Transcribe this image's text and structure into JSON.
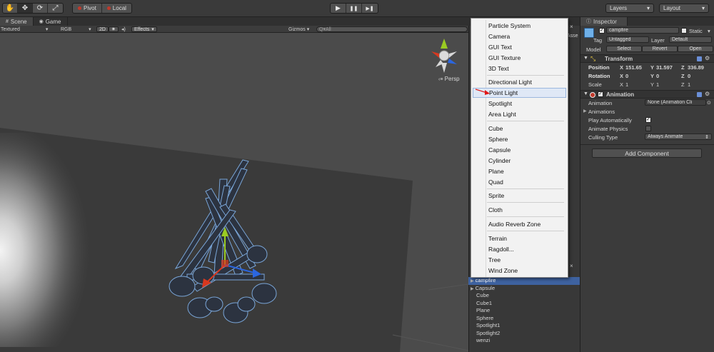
{
  "toolbar": {
    "tools": [
      "hand-icon",
      "move-icon",
      "rotate-icon",
      "scale-icon"
    ],
    "pivot_label": "Pivot",
    "local_label": "Local",
    "play_icons": [
      "▶",
      "❚❚",
      "▶❚"
    ],
    "layers_label": "Layers",
    "layout_label": "Layout"
  },
  "scene": {
    "tabs": [
      {
        "label": "Scene"
      },
      {
        "label": "Game"
      }
    ],
    "controls": {
      "shading": "Textured",
      "render_mode": "RGB",
      "mode_2d": "2D",
      "effects": "Effects",
      "gizmos": "Gizmos",
      "search_placeholder": "Q▾All"
    },
    "projection_label": "Persp"
  },
  "context_menu": {
    "items": [
      {
        "label": "Particle System"
      },
      {
        "label": "Camera"
      },
      {
        "label": "GUI Text"
      },
      {
        "label": "GUI Texture"
      },
      {
        "label": "3D Text"
      },
      {
        "label": "Directional Light"
      },
      {
        "label": "Point Light",
        "highlighted": true
      },
      {
        "label": "Spotlight"
      },
      {
        "label": "Area Light"
      },
      {
        "label": "Cube"
      },
      {
        "label": "Sphere"
      },
      {
        "label": "Capsule"
      },
      {
        "label": "Cylinder"
      },
      {
        "label": "Plane"
      },
      {
        "label": "Quad"
      },
      {
        "label": "Sprite"
      },
      {
        "label": "Cloth"
      },
      {
        "label": "Audio Reverb Zone"
      },
      {
        "label": "Terrain"
      },
      {
        "label": "Ragdoll..."
      },
      {
        "label": "Tree"
      },
      {
        "label": "Wind Zone"
      }
    ]
  },
  "hierarchy": {
    "partial_label": "Asse",
    "close_glyph": "×",
    "items": [
      {
        "label": "campfire",
        "selected": true,
        "expandable": true
      },
      {
        "label": "Capsule",
        "expandable": true
      },
      {
        "label": "Cube"
      },
      {
        "label": "Cube1"
      },
      {
        "label": "Plane"
      },
      {
        "label": "Sphere"
      },
      {
        "label": "Spotlight1"
      },
      {
        "label": "Spotlight2"
      },
      {
        "label": "wenzi"
      }
    ]
  },
  "inspector": {
    "tab_label": "Inspector",
    "object_name": "campfire",
    "static_label": "Static",
    "tag_label": "Tag",
    "tag_value": "Untagged",
    "layer_label": "Layer",
    "layer_value": "Default",
    "model_label": "Model",
    "model_buttons": [
      "Select",
      "Revert",
      "Open"
    ],
    "transform": {
      "title": "Transform",
      "position_label": "Position",
      "position": {
        "x": "151.65",
        "y": "31.597",
        "z": "336.89"
      },
      "rotation_label": "Rotation",
      "rotation": {
        "x": "0",
        "y": "0",
        "z": "0"
      },
      "scale_label": "Scale",
      "scale": {
        "x": "1",
        "y": "1",
        "z": "1"
      }
    },
    "animation": {
      "title": "Animation",
      "animation_label": "Animation",
      "animation_value": "None (Animation Cli",
      "animations_label": "Animations",
      "play_auto_label": "Play Automatically",
      "play_auto": true,
      "animate_physics_label": "Animate Physics",
      "animate_physics": false,
      "culling_label": "Culling Type",
      "culling_value": "Always Animate"
    },
    "add_component_label": "Add Component",
    "axis_labels": {
      "x": "X",
      "y": "Y",
      "z": "Z"
    }
  },
  "colors": {
    "selection": "#3e62a0",
    "menu_highlight": "#dfe8f6",
    "gizmo_x": "#d8381f",
    "gizmo_y": "#9acb22",
    "gizmo_z": "#2b66e0"
  }
}
